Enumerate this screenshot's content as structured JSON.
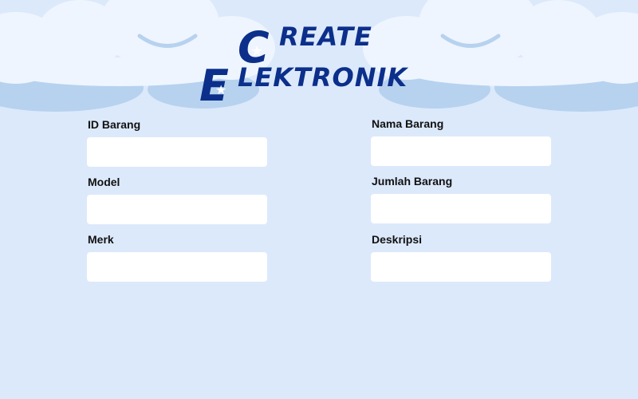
{
  "page": {
    "title_line1": "REATE",
    "title_line2": "LEKTRONIK",
    "title_initial1": "C",
    "title_initial2": "E"
  },
  "form": {
    "fields": [
      {
        "label": "ID Barang",
        "value": "",
        "placeholder": ""
      },
      {
        "label": "Nama Barang",
        "value": "",
        "placeholder": ""
      },
      {
        "label": "Model",
        "value": "",
        "placeholder": ""
      },
      {
        "label": "Jumlah Barang",
        "value": "",
        "placeholder": ""
      },
      {
        "label": "Merk",
        "value": "",
        "placeholder": ""
      },
      {
        "label": "Deskripsi",
        "value": "",
        "placeholder": ""
      }
    ]
  },
  "colors": {
    "background": "#dce9fb",
    "title": "#0b2f8a",
    "cloud_light": "#eef5fe",
    "cloud_shadow": "#b7d2ef",
    "input_bg": "#ffffff",
    "label": "#111111"
  }
}
